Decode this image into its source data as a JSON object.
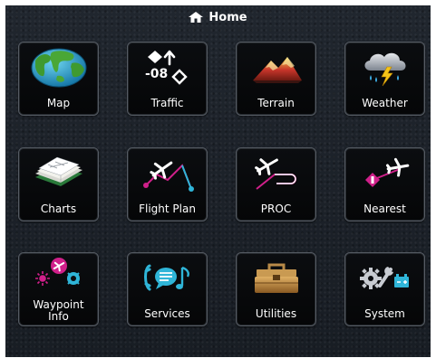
{
  "header": {
    "title": "Home",
    "icon": "home-icon"
  },
  "tiles": [
    {
      "label": "Map",
      "icon": "map-globe-icon"
    },
    {
      "label": "Traffic",
      "icon": "traffic-icon",
      "traffic_value": "-08"
    },
    {
      "label": "Terrain",
      "icon": "terrain-icon"
    },
    {
      "label": "Weather",
      "icon": "weather-icon"
    },
    {
      "label": "Charts",
      "icon": "charts-icon"
    },
    {
      "label": "Flight Plan",
      "icon": "flight-plan-icon"
    },
    {
      "label": "PROC",
      "icon": "proc-icon"
    },
    {
      "label": "Nearest",
      "icon": "nearest-icon"
    },
    {
      "label": "Waypoint\nInfo",
      "icon": "waypoint-info-icon"
    },
    {
      "label": "Services",
      "icon": "services-icon"
    },
    {
      "label": "Utilities",
      "icon": "utilities-icon"
    },
    {
      "label": "System",
      "icon": "system-icon"
    }
  ],
  "colors": {
    "background": "#1b2129",
    "tile_fill": "#050607",
    "tile_border": "#555b63",
    "text": "#ffffff",
    "accent_magenta": "#d0208a",
    "accent_cyan": "#2fb5d8"
  }
}
